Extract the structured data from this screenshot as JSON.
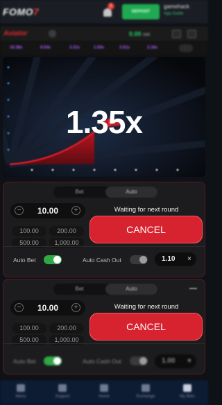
{
  "header": {
    "logo_main": "FOMO",
    "logo_accent": "7",
    "notification_count": "1",
    "deposit_label": "DEPOSIT",
    "username": "gamehack",
    "balance": "App Guide"
  },
  "game_header": {
    "title": "Aviator",
    "balance_amount": "0.00",
    "balance_currency": "INR"
  },
  "history": [
    {
      "value": "16.38x",
      "color": "#b15dff"
    },
    {
      "value": "8.54x",
      "color": "#b15dff"
    },
    {
      "value": "3.31x",
      "color": "#b15dff"
    },
    {
      "value": "1.55x",
      "color": "#b15dff"
    },
    {
      "value": "3.51x",
      "color": "#b15dff"
    },
    {
      "value": "2.16x",
      "color": "#b15dff"
    }
  ],
  "game": {
    "multiplier": "1.35x"
  },
  "panels": [
    {
      "tab_bet": "Bet",
      "tab_auto": "Auto",
      "amount": "10.00",
      "quick": [
        "100.00",
        "200.00",
        "500.00",
        "1,000.00"
      ],
      "status": "Waiting for next round",
      "cancel_label": "CANCEL",
      "auto_bet_label": "Auto Bet",
      "auto_bet_on": true,
      "auto_cashout_label": "Auto Cash Out",
      "auto_cashout_on": false,
      "cashout_value": "1.10",
      "clear_icon": "×"
    },
    {
      "tab_bet": "Bet",
      "tab_auto": "Auto",
      "amount": "10.00",
      "quick": [
        "100.00",
        "200.00",
        "500.00",
        "1,000.00"
      ],
      "status": "Waiting for next round",
      "cancel_label": "CANCEL",
      "auto_bet_label": "Auto Bet",
      "auto_bet_on": true,
      "auto_cashout_label": "Auto Cash Out",
      "auto_cashout_on": false,
      "cashout_value": "1.00",
      "clear_icon": "×"
    }
  ],
  "bottom_nav": [
    {
      "label": "Menu",
      "icon": "menu-icon"
    },
    {
      "label": "Support",
      "icon": "support-icon"
    },
    {
      "label": "Home",
      "icon": "home-icon"
    },
    {
      "label": "Exchange",
      "icon": "exchange-icon"
    },
    {
      "label": "My Bets",
      "icon": "bets-icon"
    }
  ],
  "colors": {
    "accent_red": "#d7222f",
    "toggle_green": "#2fa845",
    "deposit_green": "#1faa52"
  }
}
